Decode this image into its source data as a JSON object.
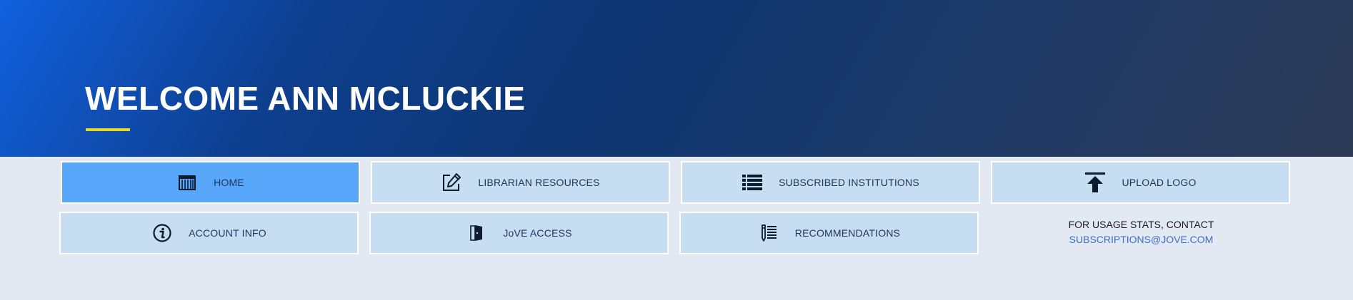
{
  "hero": {
    "title": "WELCOME ANN MCLUCKIE"
  },
  "nav": {
    "items": [
      {
        "id": "home",
        "label": "HOME",
        "icon": "building-icon",
        "active": true
      },
      {
        "id": "librarian-resources",
        "label": "LIBRARIAN RESOURCES",
        "icon": "edit-icon",
        "active": false
      },
      {
        "id": "subscribed-institutions",
        "label": "SUBSCRIBED INSTITUTIONS",
        "icon": "list-icon",
        "active": false
      },
      {
        "id": "upload-logo",
        "label": "UPLOAD LOGO",
        "icon": "upload-icon",
        "active": false
      },
      {
        "id": "account-info",
        "label": "ACCOUNT INFO",
        "icon": "info-icon",
        "active": false
      },
      {
        "id": "jove-access",
        "label": "JoVE ACCESS",
        "icon": "door-icon",
        "active": false
      },
      {
        "id": "recommendations",
        "label": "RECOMMENDATIONS",
        "icon": "pencil-list-icon",
        "active": false
      }
    ]
  },
  "contact": {
    "text": "FOR USAGE STATS, CONTACT",
    "email": "SUBSCRIPTIONS@JOVE.COM"
  },
  "colors": {
    "accent_underline": "#e3d92a",
    "button_bg": "#c6ddf2",
    "button_active_bg": "#58a7fb",
    "link": "#3a6fc9"
  }
}
